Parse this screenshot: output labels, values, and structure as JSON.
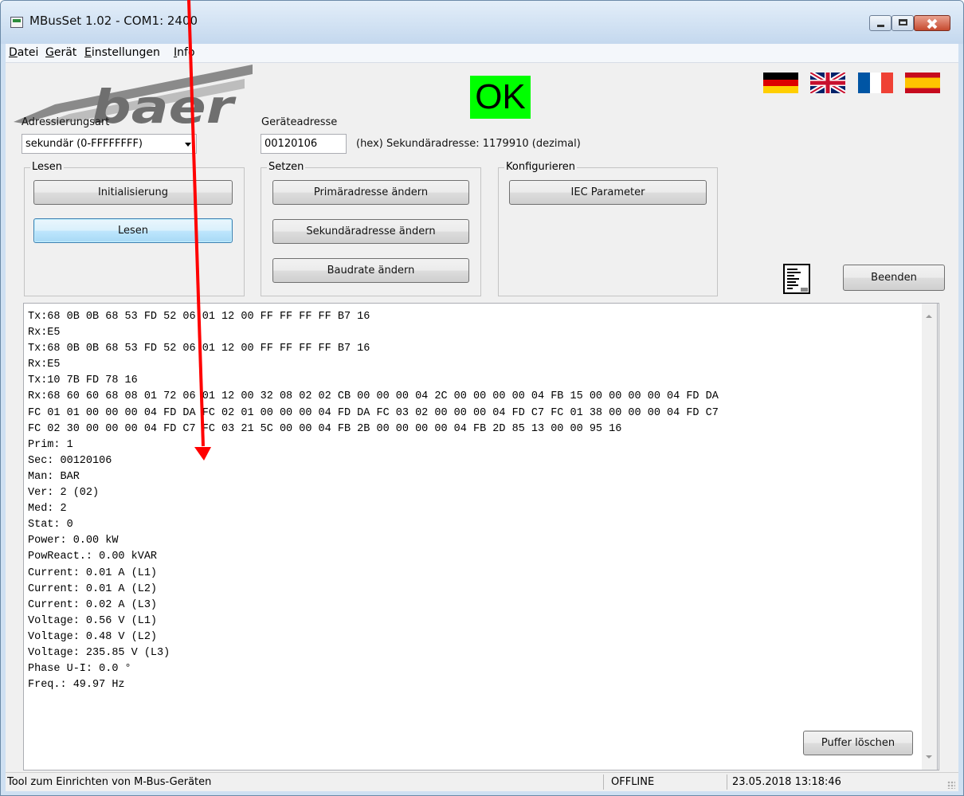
{
  "window": {
    "title": "MBusSet 1.02 - COM1: 2400"
  },
  "menu": [
    {
      "label": "Datei"
    },
    {
      "label": "Gerät"
    },
    {
      "label": "Einstellungen"
    },
    {
      "label": "Info"
    }
  ],
  "logo": {
    "text": "baer"
  },
  "status_indicator": {
    "text": "OK",
    "color": "#00ff00"
  },
  "flags": [
    "german-flag-icon",
    "uk-flag-icon",
    "french-flag-icon",
    "spanish-flag-icon"
  ],
  "addressing": {
    "label": "Adressierungsart",
    "selected": "sekundär (0-FFFFFFFF)"
  },
  "device_address": {
    "label": "Geräteadresse",
    "value": "00120106",
    "info": "(hex) Sekundäradresse: 1179910 (dezimal)"
  },
  "groups": {
    "lesen": {
      "title": "Lesen",
      "init_label": "Initialisierung",
      "read_label": "Lesen"
    },
    "setzen": {
      "title": "Setzen",
      "primary_label": "Primäradresse ändern",
      "secondary_label": "Sekundäradresse ändern",
      "baud_label": "Baudrate ändern"
    },
    "konfigurieren": {
      "title": "Konfigurieren",
      "iec_label": "IEC Parameter"
    }
  },
  "exit_label": "Beenden",
  "clear_buffer_label": "Puffer löschen",
  "console": [
    "Tx:68 0B 0B 68 53 FD 52 06 01 12 00 FF FF FF FF B7 16",
    "Rx:E5",
    "Tx:68 0B 0B 68 53 FD 52 06 01 12 00 FF FF FF FF B7 16",
    "Rx:E5",
    "Tx:10 7B FD 78 16",
    "Rx:68 60 60 68 08 01 72 06 01 12 00 32 08 02 02 CB 00 00 00 04 2C 00 00 00 00 04 FB 15 00 00 00 00 04 FD DA",
    "FC 01 01 00 00 00 04 FD DA FC 02 01 00 00 00 04 FD DA FC 03 02 00 00 00 04 FD C7 FC 01 38 00 00 00 04 FD C7",
    "FC 02 30 00 00 00 04 FD C7 FC 03 21 5C 00 00 04 FB 2B 00 00 00 00 04 FB 2D 85 13 00 00 95 16",
    "Prim: 1",
    "Sec: 00120106",
    "Man: BAR",
    "Ver: 2 (02)",
    "Med: 2",
    "Stat: 0",
    "Power: 0.00 kW",
    "PowReact.: 0.00 kVAR",
    "Current: 0.01 A (L1)",
    "Current: 0.01 A (L2)",
    "Current: 0.02 A (L3)",
    "Voltage: 0.56 V (L1)",
    "Voltage: 0.48 V (L2)",
    "Voltage: 235.85 V (L3)",
    "Phase U-I: 0.0 °",
    "Freq.: 49.97 Hz"
  ],
  "statusbar": {
    "hint": "Tool zum Einrichten von M-Bus-Geräten",
    "connection": "OFFLINE",
    "datetime": "23.05.2018 13:18:46"
  },
  "annotation": {
    "arrow_color": "#ff0000"
  }
}
